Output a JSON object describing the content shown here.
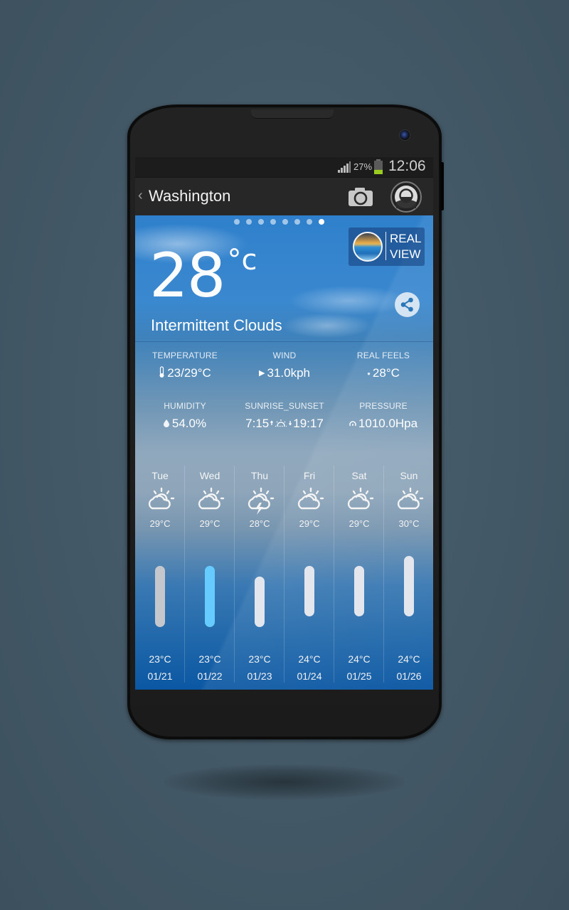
{
  "status_bar": {
    "battery_percent": "27%",
    "battery_level": 0.27,
    "time": "12:06",
    "battery_color": "#9acd1f"
  },
  "title_bar": {
    "back_glyph": "‹",
    "city": "Washington",
    "camera_icon": "camera-icon",
    "avatar_icon": "avatar-icon"
  },
  "pager": {
    "count": 8,
    "active_index": 7
  },
  "real_view": {
    "line1": "REAL",
    "line2": "VIEW"
  },
  "current": {
    "temperature": "28",
    "unit": "°c",
    "condition": "Intermittent Clouds"
  },
  "stats": [
    {
      "label": "TEMPERATURE",
      "icon": "thermometer-icon",
      "glyph": "🌡",
      "value": "23/29°C"
    },
    {
      "label": "WIND",
      "icon": "wind-direction-icon",
      "glyph": "▶",
      "value": "31.0kph"
    },
    {
      "label": "REAL FEELS",
      "icon": "sun-dot-icon",
      "glyph": "●",
      "value": "28°C"
    },
    {
      "label": "HUMIDITY",
      "icon": "humidity-drop-icon",
      "glyph": "●",
      "value": "54.0%"
    },
    {
      "label": "SUNRISE_SUNSET",
      "icon": "sunrise-sunset-icon",
      "sunrise": "7:15",
      "sunset": "19:17"
    },
    {
      "label": "PRESSURE",
      "icon": "pressure-gauge-icon",
      "glyph": "◠",
      "value": "1010.0Hpa"
    }
  ],
  "forecast": {
    "selected_index": 1,
    "colors": {
      "selected": "#66ccff",
      "past": "#c4c8cc",
      "normal": "#e4e6ee"
    },
    "days": [
      {
        "day": "Tue",
        "icon": "partly-cloudy-icon",
        "high": "29°C",
        "low": "23°C",
        "high_val": 29,
        "low_val": 23,
        "date": "01/21"
      },
      {
        "day": "Wed",
        "icon": "partly-cloudy-icon",
        "high": "29°C",
        "low": "23°C",
        "high_val": 29,
        "low_val": 23,
        "date": "01/22"
      },
      {
        "day": "Thu",
        "icon": "thunderstorm-icon",
        "high": "28°C",
        "low": "23°C",
        "high_val": 28,
        "low_val": 23,
        "date": "01/23"
      },
      {
        "day": "Fri",
        "icon": "partly-cloudy-icon",
        "high": "29°C",
        "low": "24°C",
        "high_val": 29,
        "low_val": 24,
        "date": "01/24"
      },
      {
        "day": "Sat",
        "icon": "partly-cloudy-icon",
        "high": "29°C",
        "low": "24°C",
        "high_val": 29,
        "low_val": 24,
        "date": "01/25"
      },
      {
        "day": "Sun",
        "icon": "partly-cloudy-icon",
        "high": "30°C",
        "low": "24°C",
        "high_val": 30,
        "low_val": 24,
        "date": "01/26"
      }
    ]
  }
}
